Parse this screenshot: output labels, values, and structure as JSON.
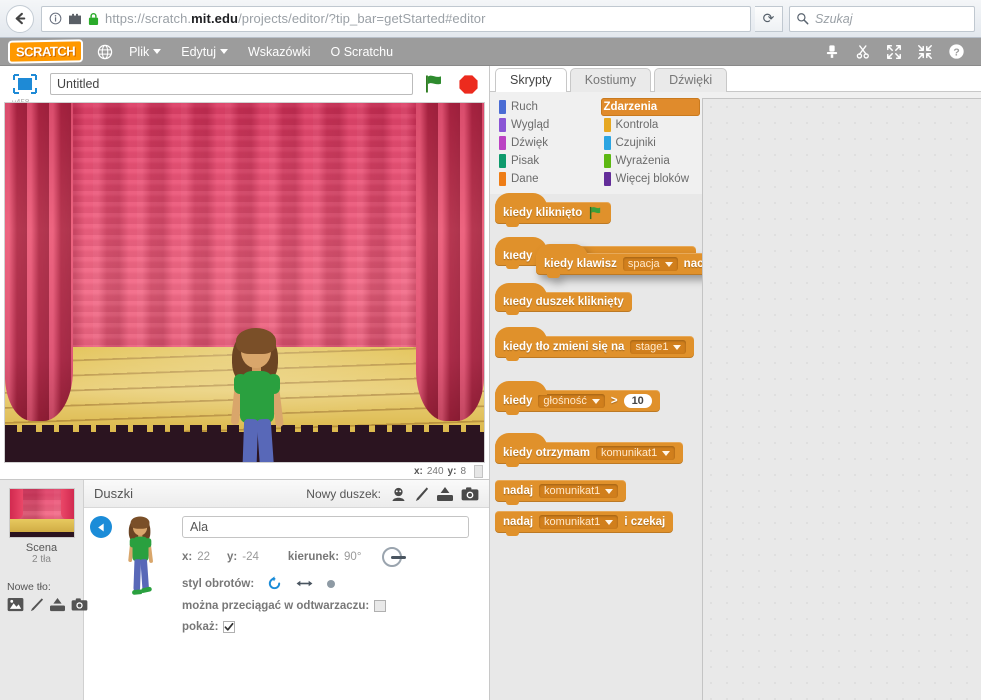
{
  "browser": {
    "back_icon": "back-arrow-icon",
    "info_icon": "info-icon",
    "apps_icon": "apps-icon",
    "lock_icon": "padlock-icon",
    "url_prefix": "https://scratch.",
    "url_domain": "mit.edu",
    "url_suffix": "/projects/editor/?tip_bar=getStarted#editor",
    "reload_label": "⟳",
    "search_placeholder": "Szukaj",
    "search_icon": "search-icon"
  },
  "menu_bar": {
    "logo": "SCRATCH",
    "globe_icon": "globe-icon",
    "items": [
      {
        "label": "Plik",
        "has_caret": true
      },
      {
        "label": "Edytuj",
        "has_caret": true
      },
      {
        "label": "Wskazówki",
        "has_caret": false
      },
      {
        "label": "O Scratchu",
        "has_caret": false
      }
    ],
    "tools": [
      "duplicate-stamp-icon",
      "scissors-delete-icon",
      "grow-icon",
      "shrink-icon",
      "help-icon"
    ]
  },
  "stage_header": {
    "presentation_icon": "fullscreen-presentation-icon",
    "version": "v458",
    "project_title": "Untitled",
    "project_title_placeholder": "Untitled",
    "green_flag_icon": "green-flag-icon",
    "stop_icon": "stop-sign-icon"
  },
  "stage": {
    "backdrop_name": "theater-curtain-backdrop",
    "sprite_name": "Ala",
    "mouse_x_label": "x:",
    "mouse_x": "240",
    "mouse_y_label": "y:",
    "mouse_y": "8"
  },
  "stage_panel": {
    "thumb_name": "scene-thumbnail",
    "label": "Scena",
    "backdrop_count": "2 tła",
    "new_backdrop_label": "Nowe tło:",
    "icons": [
      "backdrop-library-icon",
      "paint-backdrop-icon",
      "upload-backdrop-icon",
      "camera-backdrop-icon"
    ]
  },
  "sprites_panel": {
    "title": "Duszki",
    "new_sprite_label": "Nowy duszek:",
    "icons": [
      "sprite-library-icon",
      "paint-sprite-icon",
      "upload-sprite-icon",
      "camera-sprite-icon"
    ],
    "back_icon": "back-circle-icon"
  },
  "sprite_info": {
    "name": "Ala",
    "name_placeholder": "Ala",
    "x_label": "x:",
    "x_value": "22",
    "y_label": "y:",
    "y_value": "-24",
    "direction_label": "kierunek:",
    "direction_value": "90°",
    "rotation_label": "styl obrotów:",
    "rotation_icons": [
      "rotate-all-around-icon",
      "left-right-flip-icon",
      "do-not-rotate-icon"
    ],
    "draggable_label": "można przeciągać w odtwarzaczu:",
    "draggable_checked": false,
    "show_label": "pokaż:",
    "show_checked": true
  },
  "tabs": [
    {
      "label": "Skrypty",
      "active": true
    },
    {
      "label": "Kostiumy",
      "active": false
    },
    {
      "label": "Dźwięki",
      "active": false
    }
  ],
  "categories": [
    {
      "label": "Ruch",
      "color": "#4a6cd4",
      "active": false
    },
    {
      "label": "Zdarzenia",
      "color": "#e0912b",
      "active": true
    },
    {
      "label": "Wygląd",
      "color": "#8a55d5",
      "active": false
    },
    {
      "label": "Kontrola",
      "color": "#e6a822",
      "active": false
    },
    {
      "label": "Dźwięk",
      "color": "#bb42c3",
      "active": false
    },
    {
      "label": "Czujniki",
      "color": "#2ca5e2",
      "active": false
    },
    {
      "label": "Pisak",
      "color": "#0e9a6c",
      "active": false
    },
    {
      "label": "Wyrażenia",
      "color": "#5cb712",
      "active": false
    },
    {
      "label": "Dane",
      "color": "#ee7d16",
      "active": false
    },
    {
      "label": "Więcej bloków",
      "color": "#632d99",
      "active": false
    }
  ],
  "palette_blocks": [
    {
      "id": "when-flag-clicked",
      "text": "kiedy kliknięto",
      "icon": "green-flag-icon",
      "hat": true
    },
    {
      "id": "when-key-pressed-palette",
      "text": "kiedy",
      "hat": true
    },
    {
      "id": "when-sprite-clicked",
      "text": "kiedy duszek kliknięty",
      "hat": true
    },
    {
      "id": "when-backdrop-switches",
      "text_before": "kiedy tło zmieni się na",
      "dropdown": "stage1",
      "hat": true
    },
    {
      "id": "when-greater-than",
      "text_before": "kiedy",
      "dropdown": "głośność",
      "operator": ">",
      "value": "10",
      "hat": true
    },
    {
      "id": "when-i-receive",
      "text_before": "kiedy otrzymam",
      "dropdown": "komunikat1",
      "hat": true
    },
    {
      "id": "broadcast",
      "text_before": "nadaj",
      "dropdown": "komunikat1",
      "hat": false
    },
    {
      "id": "broadcast-and-wait",
      "text_before": "nadaj",
      "dropdown": "komunikat1",
      "text_after": "i czekaj",
      "hat": false
    }
  ],
  "dragged_block": {
    "id": "when-key-pressed-dragged",
    "text_before": "kiedy klawisz",
    "dropdown": "spacja",
    "text_after": "naciśnięty"
  },
  "colors": {
    "events_block": "#e0912b",
    "menu_bar": "#9c9c9c",
    "scratch_orange": "#ff9400",
    "canvas_bg": "#e9e9e9",
    "palette_bg": "#e8e8e8"
  }
}
